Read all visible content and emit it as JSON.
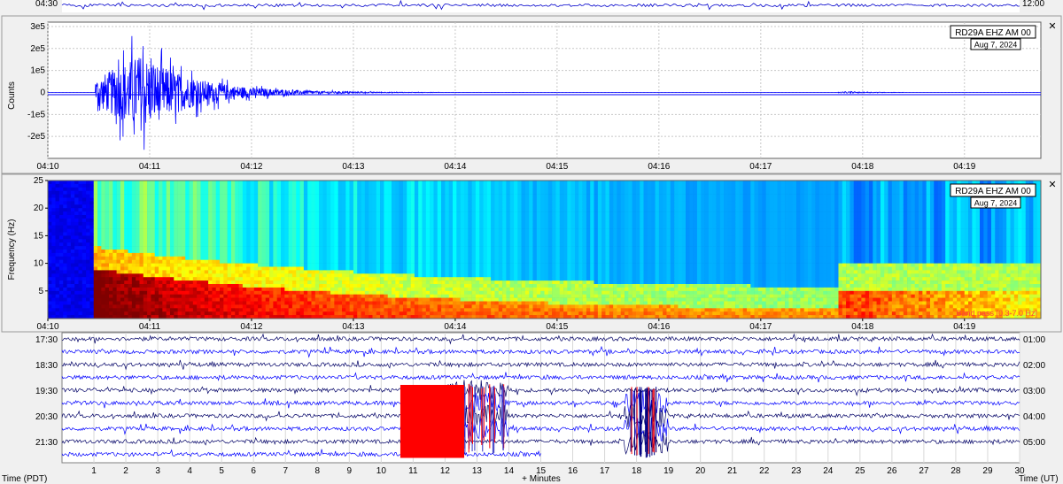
{
  "top_strip": {
    "left_time": "04:30",
    "right_time": "12:00"
  },
  "waveform_panel": {
    "station": "RD29A EHZ AM 00",
    "date": "Aug 7, 2024",
    "close_glyph": "✕",
    "ylabel": "Counts"
  },
  "spectrogram_panel": {
    "station": "RD29A EHZ AM 00",
    "date": "Aug 7, 2024",
    "close_glyph": "✕",
    "ylabel": "Frequency (Hz)",
    "filter_note": "Band pass [0.3-7.0 Hz]"
  },
  "helicorder": {
    "xlabel_left": "Time (PDT)",
    "xlabel_center": "+ Minutes",
    "xlabel_right": "Time (UT)",
    "row_left_labels": [
      "17:30",
      "18:30",
      "19:30",
      "20:30",
      "21:30"
    ],
    "row_right_labels": [
      "01:00",
      "02:00",
      "03:00",
      "04:00",
      "05:00"
    ],
    "trace_colors": [
      "#000066",
      "#0000ff"
    ],
    "event_color": "#ff0000"
  },
  "chart_data": [
    {
      "type": "line",
      "name": "waveform",
      "ylabel": "Counts",
      "y_ticks": [
        {
          "value": 300000,
          "label": "3e5"
        },
        {
          "value": 200000,
          "label": "2e5"
        },
        {
          "value": 100000,
          "label": "1e5"
        },
        {
          "value": 0,
          "label": "0"
        },
        {
          "value": -100000,
          "label": "-1e5"
        },
        {
          "value": -200000,
          "label": "-2e5"
        }
      ],
      "ylim": [
        -300000,
        320000
      ],
      "xlim": [
        "04:10",
        "04:19:45"
      ],
      "x_ticks": [
        "04:10",
        "04:11",
        "04:12",
        "04:13",
        "04:14",
        "04:15",
        "04:16",
        "04:17",
        "04:18",
        "04:19"
      ],
      "grid": true,
      "series_color": "#0000ff",
      "events": [
        {
          "onset": "04:10:28",
          "peak_time": "04:10:55",
          "peak_amplitude": 320000
        },
        {
          "onset": "04:17:45",
          "peak_time": "04:17:50",
          "peak_amplitude": 6000
        }
      ]
    },
    {
      "type": "heatmap",
      "name": "spectrogram",
      "ylabel": "Frequency (Hz)",
      "y_ticks": [
        5,
        10,
        15,
        20,
        25
      ],
      "ylim": [
        0,
        25
      ],
      "xlim": [
        "04:10",
        "04:19:45"
      ],
      "x_ticks": [
        "04:10",
        "04:11",
        "04:12",
        "04:13",
        "04:14",
        "04:15",
        "04:16",
        "04:17",
        "04:18",
        "04:19"
      ],
      "colormap": "jet",
      "events": [
        {
          "onset": "04:10:28"
        },
        {
          "onset": "04:17:45"
        }
      ]
    },
    {
      "type": "line",
      "name": "helicorder",
      "x_ticks": [
        1,
        2,
        3,
        4,
        5,
        6,
        7,
        8,
        9,
        10,
        11,
        12,
        13,
        14,
        15,
        16,
        17,
        18,
        19,
        20,
        21,
        22,
        23,
        24,
        25,
        26,
        27,
        28,
        29,
        30
      ],
      "xlim": [
        0,
        30
      ],
      "xlabel": "+ Minutes"
    }
  ]
}
